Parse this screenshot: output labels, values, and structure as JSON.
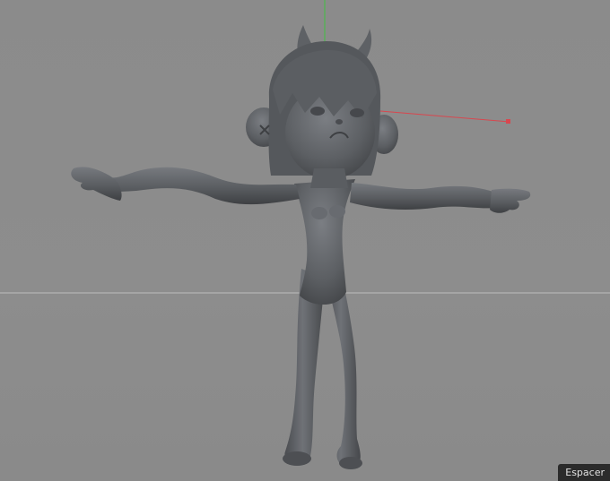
{
  "viewport": {
    "background": "#8c8c8c",
    "space_label": "Espacer"
  },
  "axes": {
    "y_axis_color": "#3fc03f",
    "x_axis_color": "#d8474f",
    "horizon_color": "#bdbdbd"
  },
  "model": {
    "description_icon": "character-mesh-icon",
    "color": "#5a5c60"
  }
}
